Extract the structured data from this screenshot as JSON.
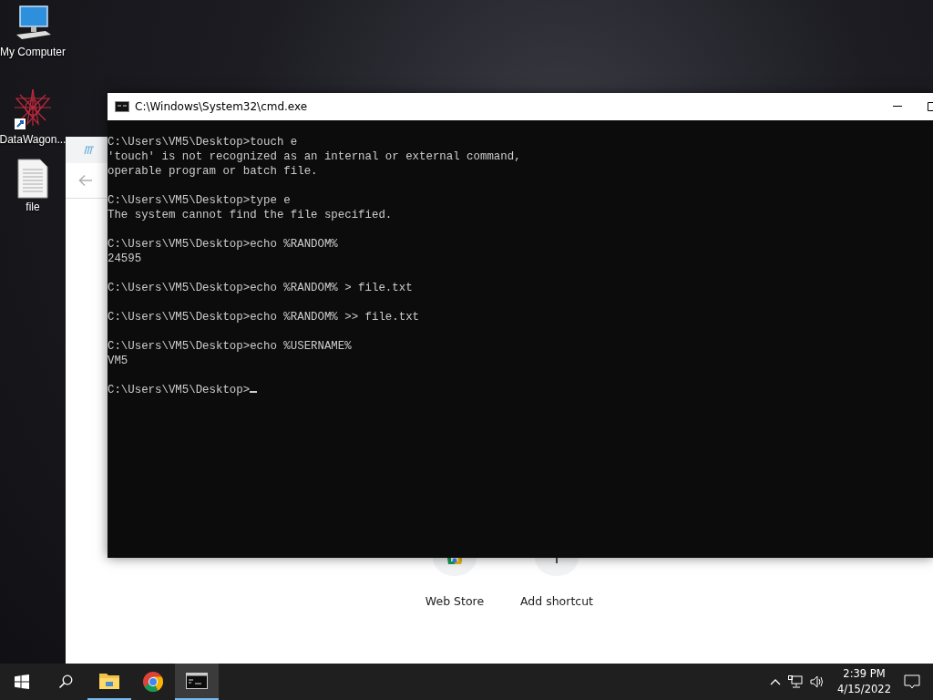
{
  "desktop_icons": [
    {
      "kind": "computer",
      "label": "My Computer"
    },
    {
      "kind": "shortcut",
      "label": "DataWagon..."
    },
    {
      "kind": "document",
      "label": "file"
    }
  ],
  "browser": {
    "tiles": [
      {
        "kind": "store",
        "label": "Web Store"
      },
      {
        "kind": "add",
        "label": "Add shortcut"
      }
    ]
  },
  "console": {
    "title": "C:\\Windows\\System32\\cmd.exe",
    "entries": [
      {
        "prompt": "C:\\Users\\VM5\\Desktop>",
        "command": "touch e",
        "output": [
          "'touch' is not recognized as an internal or external command,",
          "operable program or batch file."
        ]
      },
      {
        "prompt": "C:\\Users\\VM5\\Desktop>",
        "command": "type e",
        "output": [
          "The system cannot find the file specified."
        ]
      },
      {
        "prompt": "C:\\Users\\VM5\\Desktop>",
        "command": "echo %RANDOM%",
        "output": [
          "24595"
        ]
      },
      {
        "prompt": "C:\\Users\\VM5\\Desktop>",
        "command": "echo %RANDOM% > file.txt"
      },
      {
        "prompt": "C:\\Users\\VM5\\Desktop>",
        "command": "echo %RANDOM% >> file.txt"
      },
      {
        "prompt": "C:\\Users\\VM5\\Desktop>",
        "command": "echo %USERNAME%",
        "output": [
          "VM5"
        ]
      },
      {
        "prompt": "C:\\Users\\VM5\\Desktop>",
        "cursor": true
      }
    ]
  },
  "taskbar": {
    "apps": [
      {
        "kind": "start",
        "running": false,
        "selected": false
      },
      {
        "kind": "search",
        "running": false,
        "selected": false
      },
      {
        "kind": "explorer",
        "running": true,
        "selected": false
      },
      {
        "kind": "chrome",
        "running": false,
        "selected": false
      },
      {
        "kind": "terminal",
        "running": true,
        "selected": true
      }
    ],
    "time": "2:39 PM",
    "date": "4/15/2022"
  }
}
